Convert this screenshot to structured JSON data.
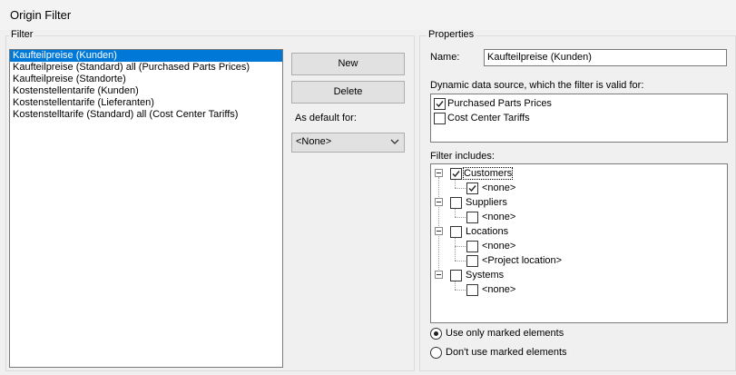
{
  "window": {
    "title": "Origin Filter"
  },
  "filter_group": {
    "label": "Filter",
    "items": [
      "Kaufteilpreise (Kunden)",
      "Kaufteilpreise (Standard) all (Purchased Parts Prices)",
      "Kaufteilpreise (Standorte)",
      "Kostenstellentarife (Kunden)",
      "Kostenstellentarife (Lieferanten)",
      "Kostenstelltarife (Standard) all (Cost Center Tariffs)"
    ],
    "selected_index": 0
  },
  "actions": {
    "new_label": "New",
    "delete_label": "Delete",
    "default_label": "As default for:",
    "default_value": "<None>"
  },
  "properties": {
    "label": "Properties",
    "name_label": "Name:",
    "name_value": "Kaufteilpreise (Kunden)",
    "data_source_label": "Dynamic data source, which the filter is valid for:",
    "data_sources": [
      {
        "label": "Purchased Parts Prices",
        "checked": true
      },
      {
        "label": "Cost Center Tariffs",
        "checked": false
      }
    ],
    "includes_label": "Filter includes:",
    "tree": {
      "customers": {
        "label": "Customers",
        "checked": true
      },
      "customers_none": {
        "label": "<none>",
        "checked": true
      },
      "suppliers": {
        "label": "Suppliers",
        "checked": false
      },
      "suppliers_none": {
        "label": "<none>",
        "checked": false
      },
      "locations": {
        "label": "Locations",
        "checked": false
      },
      "locations_none": {
        "label": "<none>",
        "checked": false
      },
      "locations_project": {
        "label": "<Project location>",
        "checked": false
      },
      "systems": {
        "label": "Systems",
        "checked": false
      },
      "systems_none": {
        "label": "<none>",
        "checked": false
      }
    },
    "mode": {
      "use_marked": "Use only marked elements",
      "dont_use_marked": "Don't use marked elements",
      "selected": "use_marked"
    }
  }
}
